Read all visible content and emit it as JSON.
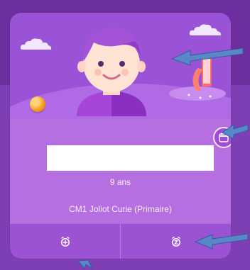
{
  "profile": {
    "name_value": "",
    "age_text": "9 ans",
    "class_text": "CM1 Joliot Curie (Primaire)"
  },
  "icons": {
    "calendar": "calendar-icon",
    "alarm_add": "alarm-plus-icon",
    "alarm_snooze": "alarm-z-icon"
  },
  "colors": {
    "card": "#8a43c6",
    "card_body": "#b56fe0",
    "footer": "#9b52d3",
    "arrow": "#5b86c8"
  }
}
